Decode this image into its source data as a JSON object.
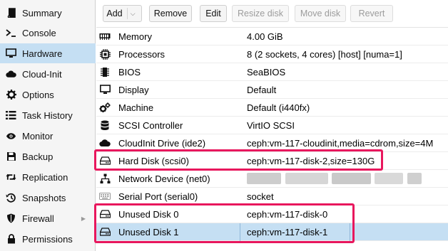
{
  "sidebar": {
    "items": [
      {
        "label": "Summary",
        "icon": "book-icon"
      },
      {
        "label": "Console",
        "icon": "terminal-icon"
      },
      {
        "label": "Hardware",
        "icon": "monitor-icon"
      },
      {
        "label": "Cloud-Init",
        "icon": "cloud-icon"
      },
      {
        "label": "Options",
        "icon": "gear-icon"
      },
      {
        "label": "Task History",
        "icon": "list-icon"
      },
      {
        "label": "Monitor",
        "icon": "eye-icon"
      },
      {
        "label": "Backup",
        "icon": "floppy-icon"
      },
      {
        "label": "Replication",
        "icon": "retweet-icon"
      },
      {
        "label": "Snapshots",
        "icon": "history-icon"
      },
      {
        "label": "Firewall",
        "icon": "shield-icon"
      },
      {
        "label": "Permissions",
        "icon": "lock-icon"
      }
    ],
    "active": "Hardware"
  },
  "toolbar": {
    "add_label": "Add",
    "remove_label": "Remove",
    "edit_label": "Edit",
    "resize_label": "Resize disk",
    "move_label": "Move disk",
    "revert_label": "Revert"
  },
  "hardware": {
    "rows": [
      {
        "name": "Memory",
        "value": "4.00 GiB",
        "icon": "memory-icon"
      },
      {
        "name": "Processors",
        "value": "8 (2 sockets, 4 cores) [host] [numa=1]",
        "icon": "cpu-icon"
      },
      {
        "name": "BIOS",
        "value": "SeaBIOS",
        "icon": "microchip-icon"
      },
      {
        "name": "Display",
        "value": "Default",
        "icon": "desktop-icon"
      },
      {
        "name": "Machine",
        "value": "Default (i440fx)",
        "icon": "cogs-icon"
      },
      {
        "name": "SCSI Controller",
        "value": "VirtIO SCSI",
        "icon": "database-icon"
      },
      {
        "name": "CloudInit Drive (ide2)",
        "value": "ceph:vm-117-cloudinit,media=cdrom,size=4M",
        "icon": "cloud-icon"
      },
      {
        "name": "Hard Disk (scsi0)",
        "value": "ceph:vm-117-disk-2,size=130G",
        "icon": "hdd-icon"
      },
      {
        "name": "Network Device (net0)",
        "value": "",
        "icon": "network-icon"
      },
      {
        "name": "Serial Port (serial0)",
        "value": "socket",
        "icon": "keyboard-icon"
      },
      {
        "name": "Unused Disk 0",
        "value": "ceph:vm-117-disk-0",
        "icon": "hdd-icon"
      },
      {
        "name": "Unused Disk 1",
        "value": "ceph:vm-117-disk-1",
        "icon": "hdd-icon"
      }
    ],
    "selected": "Unused Disk 1"
  },
  "colors": {
    "selection": "#c5dff3",
    "highlight_box": "#e8175d"
  }
}
